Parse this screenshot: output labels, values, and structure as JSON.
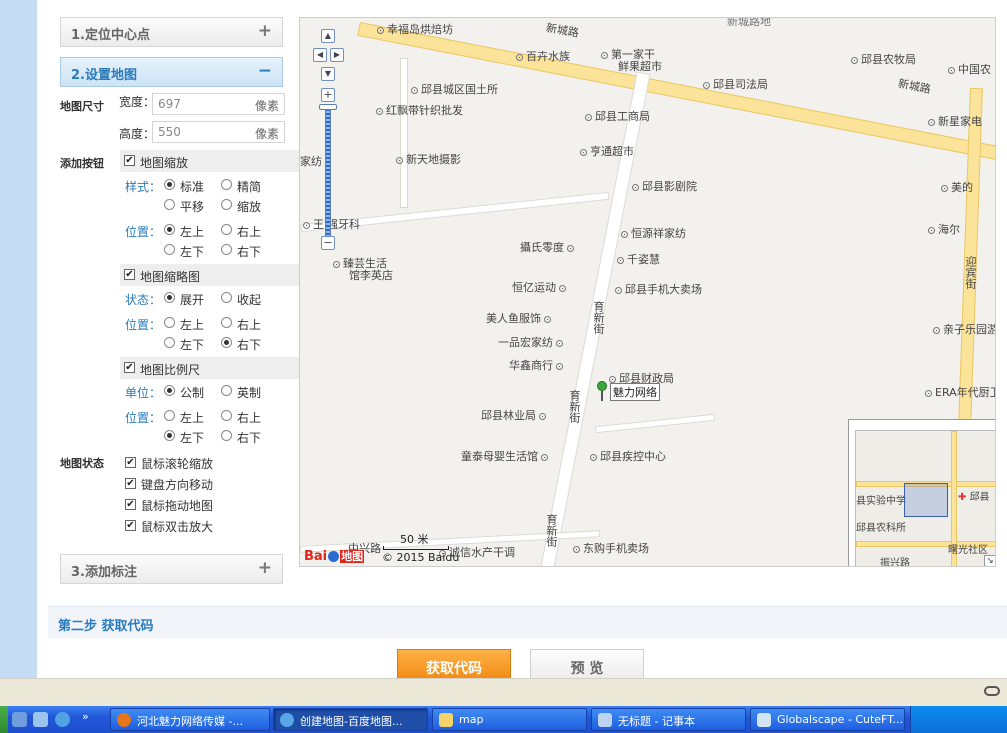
{
  "left_panel": {
    "sections": [
      {
        "label": "1.定位中心点",
        "toggle": "+"
      },
      {
        "label": "2.设置地图",
        "toggle": "−"
      },
      {
        "label": "3.添加标注",
        "toggle": "+"
      }
    ],
    "size": {
      "label": "地图尺寸",
      "width_label": "宽度：",
      "width_value": "697",
      "height_label": "高度：",
      "height_value": "550",
      "unit": "像素"
    },
    "buttons_label": "添加按钮",
    "zoom": {
      "checkbox": "地图缩放",
      "style_label": "样式：",
      "styles": [
        "标准",
        "精简",
        "平移",
        "缩放"
      ],
      "pos_label": "位置：",
      "positions": [
        "左上",
        "右上",
        "左下",
        "右下"
      ]
    },
    "overview": {
      "checkbox": "地图缩略图",
      "state_label": "状态：",
      "states": [
        "展开",
        "收起"
      ],
      "pos_label": "位置：",
      "positions": [
        "左上",
        "右上",
        "左下",
        "右下"
      ]
    },
    "scale": {
      "checkbox": "地图比例尺",
      "unit_label": "单位：",
      "units": [
        "公制",
        "英制"
      ],
      "pos_label": "位置：",
      "positions": [
        "左上",
        "右上",
        "左下",
        "右下"
      ]
    },
    "state": {
      "label": "地图状态",
      "options": [
        "鼠标滚轮缩放",
        "键盘方向移动",
        "鼠标拖动地图",
        "鼠标双击放大"
      ]
    }
  },
  "map": {
    "top_cut": "新城路地",
    "roads": [
      "新城路",
      "新城路",
      "育新街",
      "育新街",
      "育新街",
      "迎宾街",
      "振兴路"
    ],
    "pois": [
      "幸福岛烘焙坊",
      "百卉水族",
      "第一家干",
      "鲜果超市",
      "邱县农牧局",
      "中国农",
      "邱县城区国土所",
      "邱县司法局",
      "红飘带针织批发",
      "邱县工商局",
      "新星家电",
      "家纺",
      "新天地摄影",
      "亨通超市",
      "邱县影剧院",
      "美的",
      "王",
      "强牙科",
      "恒源祥家纺",
      "海尔",
      "攝氏零度",
      "千姿慧",
      "臻芸生活",
      "馆李英店",
      "恒亿运动",
      "邱县手机大卖场",
      "美人鱼服饰",
      "亲子乐园游",
      "一品宏家纺",
      "华鑫商行",
      "邱县财政局",
      "ERA年代厨卫",
      "邱县林业局",
      "童泰母婴生活馆",
      "邱县疾控中心",
      "中兴路",
      "诚信水产干调",
      "东购手机卖场"
    ],
    "marker_label": "魅力网络",
    "scale_label": "50 米",
    "baidu_logo": "Bai",
    "baidu_logo_map": "地图",
    "copyright": "© 2015 Baidu",
    "overview_labels": [
      "县实验中学",
      "邱县",
      "邱县农科所",
      "曙光社区",
      "振兴路"
    ]
  },
  "step2": {
    "label": "第二步 获取代码"
  },
  "actions": {
    "get_code": "获取代码",
    "preview": "预 览"
  },
  "taskbar": {
    "tasks": [
      "河北魅力网络传媒 -...",
      "创建地图-百度地图...",
      "map",
      "无标题 - 记事本",
      "Globalscape - CuteFT..."
    ]
  },
  "colors": {
    "accent": "#2a7bbd",
    "button_orange": "#f4961e",
    "taskbar": "#2157d7"
  }
}
